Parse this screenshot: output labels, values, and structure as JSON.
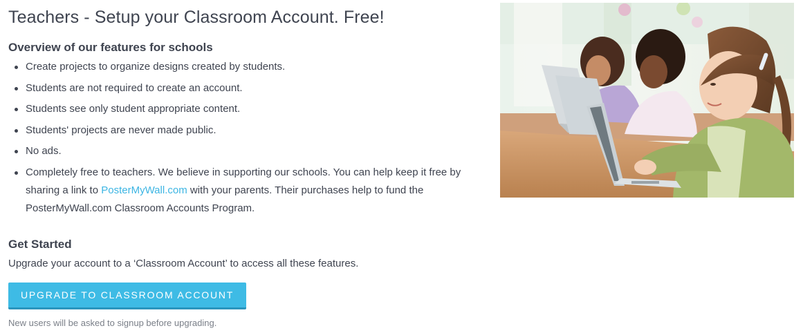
{
  "page": {
    "title": "Teachers - Setup your Classroom Account. Free!"
  },
  "overview": {
    "heading": "Overview of our features for schools",
    "features": [
      "Create projects to organize designs created by students.",
      "Students are not required to create an account.",
      "Students see only student appropriate content.",
      "Students' projects are never made public.",
      "No ads."
    ],
    "last_feature": {
      "text_before_link": "Completely free to teachers. We believe in supporting our schools. You can help keep it free by sharing a link to ",
      "link_text": "PosterMyWall.com",
      "text_after_link": " with your parents. Their purchases help to fund the PosterMyWall.com Classroom Accounts Program."
    }
  },
  "get_started": {
    "heading": "Get Started",
    "description": "Upgrade your account to a ‘Classroom Account’ to access all these features.",
    "button_label": "UPGRADE TO CLASSROOM ACCOUNT",
    "note": "New users will be asked to signup before upgrading."
  },
  "colors": {
    "accent": "#3ebbe5",
    "link": "#3cb5e3",
    "text": "#3f4450"
  }
}
